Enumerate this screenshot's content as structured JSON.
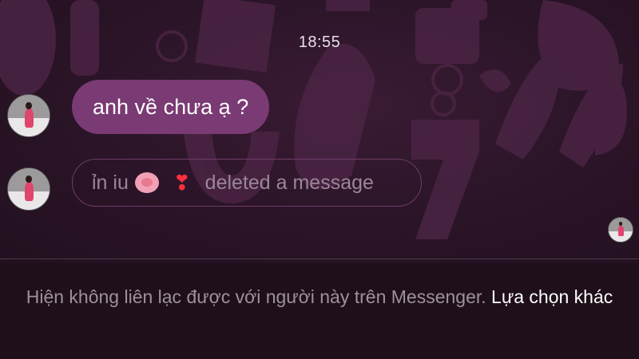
{
  "status_time": "18:55",
  "messages": [
    {
      "text": "anh về chưa ạ ?"
    },
    {
      "sender_label": "ỉn iu",
      "heart": "❣",
      "deleted_text": "deleted a message"
    }
  ],
  "footer": {
    "notice": "Hiện không liên lạc được với người này trên Messenger.",
    "link": "Lựa chọn khác"
  },
  "colors": {
    "background": "#1e0f1a",
    "bubble": "#7a3a73",
    "deleted_border": "#6e3c67",
    "muted_text": "#9d929c"
  },
  "icons": [
    "avatar",
    "pig-face-emoji",
    "heart-exclamation-emoji",
    "read-receipt-avatar"
  ]
}
